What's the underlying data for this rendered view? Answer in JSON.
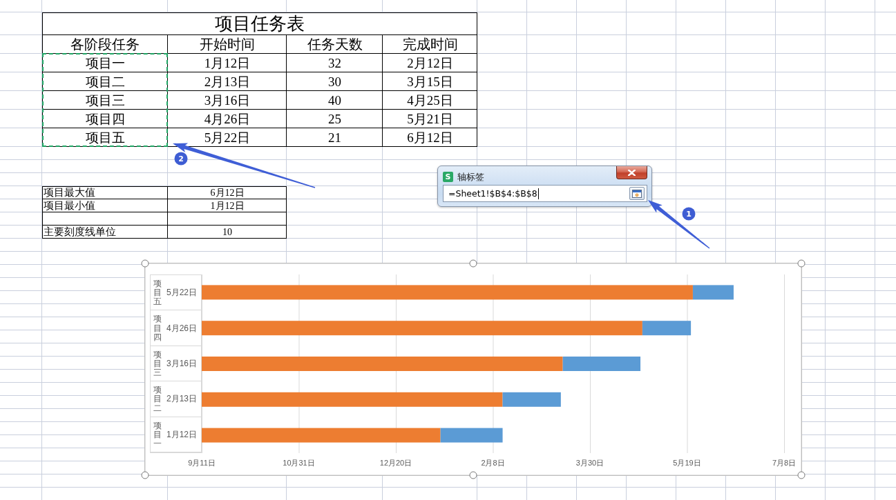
{
  "task_table": {
    "title": "项目任务表",
    "columns": [
      "各阶段任务",
      "开始时间",
      "任务天数",
      "完成时间"
    ],
    "rows": [
      {
        "cells": [
          "项目一",
          "1月12日",
          "32",
          "2月12日"
        ],
        "in_selection": true
      },
      {
        "cells": [
          "项目二",
          "2月13日",
          "30",
          "3月15日"
        ],
        "in_selection": true
      },
      {
        "cells": [
          "项目三",
          "3月16日",
          "40",
          "4月25日"
        ],
        "in_selection": true
      },
      {
        "cells": [
          "项目四",
          "4月26日",
          "25",
          "5月21日"
        ],
        "in_selection": true
      },
      {
        "cells": [
          "项目五",
          "5月22日",
          "21",
          "6月12日"
        ],
        "in_selection": true
      }
    ]
  },
  "summary_table": {
    "rows": [
      {
        "kind": "entry",
        "label": "项目最大值",
        "value": "6月12日"
      },
      {
        "kind": "entry",
        "label": "项目最小值",
        "value": "1月12日"
      },
      {
        "kind": "blank"
      },
      {
        "kind": "entry",
        "label": "主要刻度线单位",
        "value": "10"
      }
    ]
  },
  "dialog": {
    "logo": "S",
    "title": "轴标签",
    "field": {
      "value": "=Sheet1!$B$4:$B$8",
      "focused": true
    }
  },
  "chart": {
    "selected": true,
    "categories": [
      {
        "group": "项目五",
        "label": "5月22日"
      },
      {
        "group": "项目四",
        "label": "4月26日"
      },
      {
        "group": "项目三",
        "label": "3月16日"
      },
      {
        "group": "项目二",
        "label": "2月13日"
      },
      {
        "group": "项目一",
        "label": "1月12日"
      }
    ],
    "axis_labels": [
      "9月11日",
      "10月31日",
      "12月20日",
      "2月8日",
      "3月30日",
      "5月19日",
      "7月8日"
    ]
  },
  "annotations": [
    {
      "number": "1"
    },
    {
      "number": "2"
    }
  ]
}
